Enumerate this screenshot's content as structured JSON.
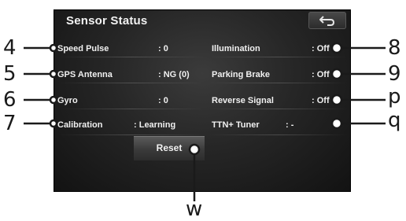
{
  "screen": {
    "title": "Sensor Status",
    "back_icon": "back-arrow-icon"
  },
  "left_rows": [
    {
      "label": "Speed Pulse",
      "value": ": 0"
    },
    {
      "label": "GPS Antenna",
      "value": ": NG (0)"
    },
    {
      "label": "Gyro",
      "value": ": 0"
    },
    {
      "label": "Calibration",
      "value": ": Learning"
    }
  ],
  "right_rows": [
    {
      "label": "Illumination",
      "value": ": Off"
    },
    {
      "label": "Parking Brake",
      "value": ": Off"
    },
    {
      "label": "Reverse Signal",
      "value": ": Off"
    },
    {
      "label": "TTN+ Tuner",
      "value": ": -"
    }
  ],
  "reset_label": "Reset",
  "callouts": {
    "left": [
      "4",
      "5",
      "6",
      "7"
    ],
    "right": [
      "8",
      "9",
      "p",
      "q"
    ],
    "bottom": "w"
  }
}
